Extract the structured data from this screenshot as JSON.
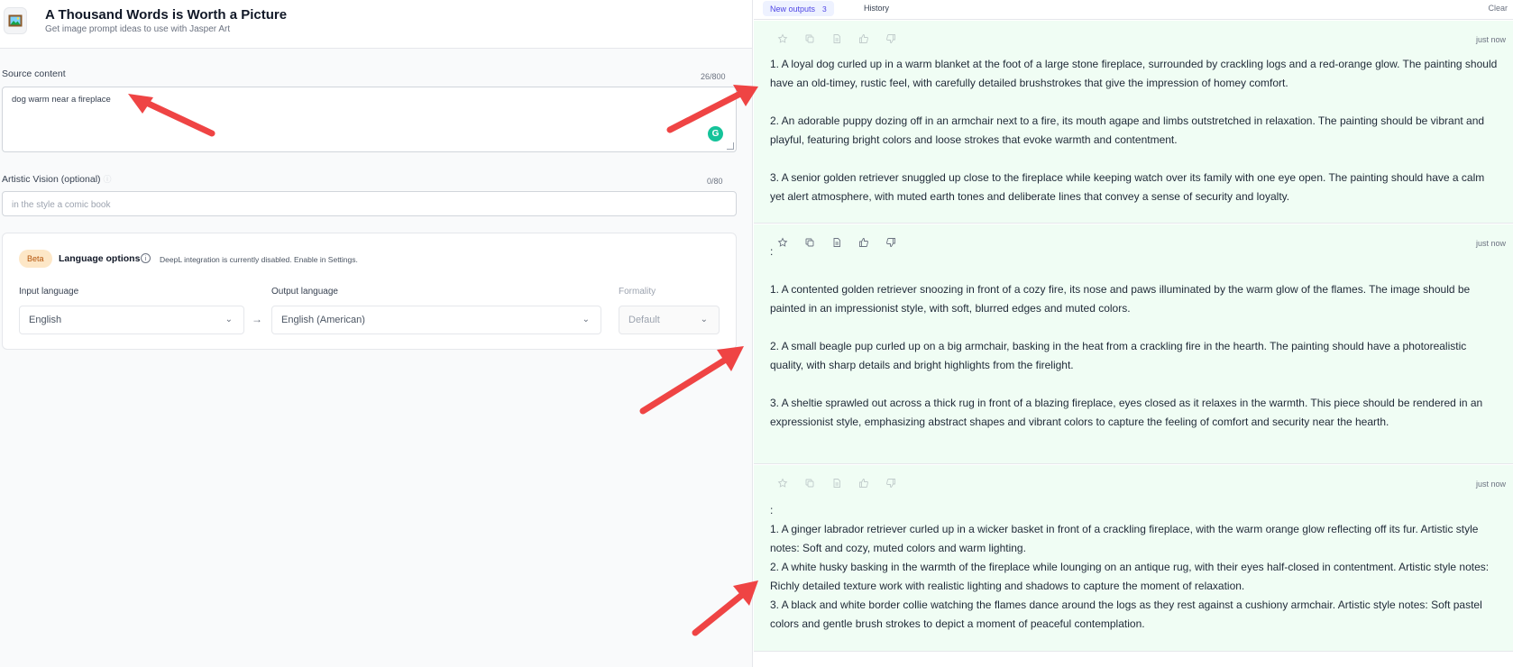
{
  "header": {
    "title": "A Thousand Words is Worth a Picture",
    "subtitle": "Get image prompt ideas to use with Jasper Art"
  },
  "source": {
    "label": "Source content",
    "counter": "26/800",
    "value": "dog warm near a fireplace"
  },
  "vision": {
    "label": "Artistic Vision (optional)",
    "counter": "0/80",
    "placeholder": "in the style a comic book"
  },
  "language": {
    "badge": "Beta",
    "title": "Language options",
    "note": "DeepL integration is currently disabled. Enable in Settings.",
    "input_label": "Input language",
    "input_value": "English",
    "output_label": "Output language",
    "output_value": "English (American)",
    "formality_label": "Formality",
    "formality_value": "Default"
  },
  "tabs": {
    "new_outputs": "New outputs",
    "new_count": "3",
    "history": "History",
    "clear": "Clear"
  },
  "outputs": [
    {
      "timestamp": "just now",
      "lines": [
        "1. A loyal dog curled up in a warm blanket at the foot of a large stone fireplace, surrounded by crackling logs and a red-orange glow. The painting should have an old-timey, rustic feel, with carefully detailed brushstrokes that give the impression of homey comfort.",
        "",
        "2. An adorable puppy dozing off in an armchair next to a fire, its mouth agape and limbs outstretched in relaxation. The painting should be vibrant and playful, featuring bright colors and loose strokes that evoke warmth and contentment.",
        "",
        "3. A senior golden retriever snuggled up close to the fireplace while keeping watch over its family with one eye open. The painting should have a calm yet alert atmosphere, with muted earth tones and deliberate lines that convey a sense of security and loyalty."
      ]
    },
    {
      "timestamp": "just now",
      "lines": [
        ":",
        "",
        "1. A contented golden retriever snoozing in front of a cozy fire, its nose and paws illuminated by the warm glow of the flames. The image should be painted in an impressionist style, with soft, blurred edges and muted colors.",
        "",
        "2. A small beagle pup curled up on a big armchair, basking in the heat from a crackling fire in the hearth. The painting should have a photorealistic quality, with sharp details and bright highlights from the firelight.",
        "",
        "3. A sheltie sprawled out across a thick rug in front of a blazing fireplace, eyes closed as it relaxes in the warmth. This piece should be rendered in an expressionist style, emphasizing abstract shapes and vibrant colors to capture the feeling of comfort and security near the hearth."
      ]
    },
    {
      "timestamp": "just now",
      "lines": [
        ":",
        "1. A ginger labrador retriever curled up in a wicker basket in front of a crackling fireplace, with the warm orange glow reflecting off its fur. Artistic style notes: Soft and cozy, muted colors and warm lighting.",
        "2. A white husky basking in the warmth of the fireplace while lounging on an antique rug, with their eyes half-closed in contentment. Artistic style notes: Richly detailed texture work with realistic lighting and shadows to capture the moment of relaxation.",
        "3. A black and white border collie watching the flames dance around the logs as they rest against a cushiony armchair. Artistic style notes: Soft pastel colors and gentle brush strokes to depict a moment of peaceful contemplation."
      ]
    }
  ],
  "colors": {
    "card_bg": "#f0fdf4",
    "accent": "#4f46e5",
    "annotation_arrow": "#ef4444",
    "grammarly": "#15c39a"
  }
}
